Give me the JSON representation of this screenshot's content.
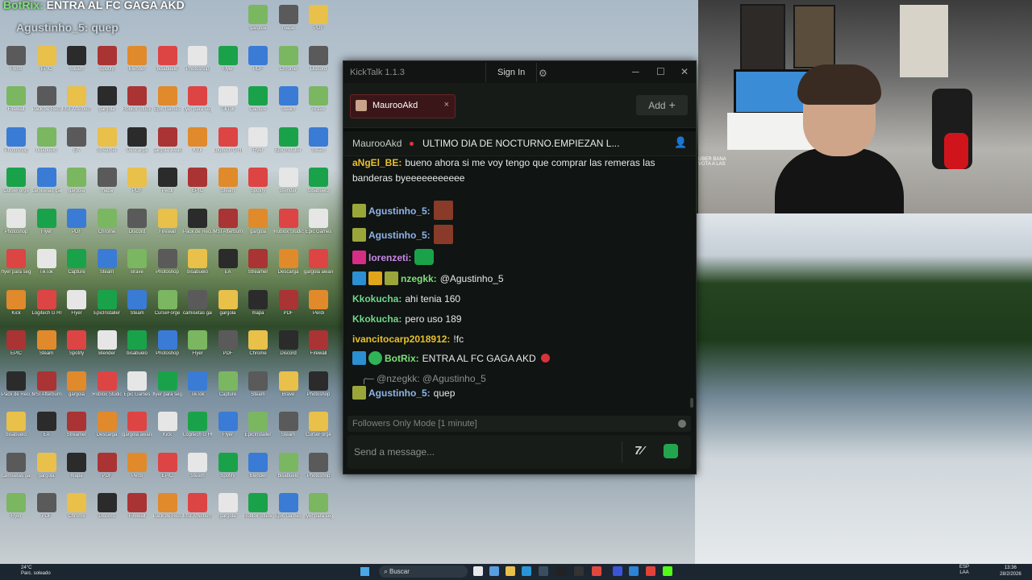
{
  "desktop": {
    "overlay_top_username": "BotRix:",
    "overlay_top_message": "ENTRA AL FC GAGA AKD",
    "overlay_second": "Agustinho_5: quep",
    "icons": [
      "gargola",
      "mapa",
      "PDF",
      "Perdi",
      "EPIC",
      "Steam",
      "Spotify",
      "Blender",
      "bisabuelo",
      "Photoshop",
      "Flyer",
      "PDF",
      "Chrome",
      "Discord",
      "Firewall",
      "Pack de Recursos",
      "MSI Afterburner",
      "gargola",
      "Roblox Studio",
      "Epic Games",
      "flyer para seguir",
      "TikTok",
      "Capture",
      "Steam",
      "Brave",
      "Photoshop",
      "bisabuelo",
      "EA",
      "Streamer",
      "Descarga",
      "gargola awards",
      "Kick",
      "Logitech G HUB",
      "Flyer",
      "EpicInstaller",
      "Steam",
      "CurseForge",
      "camisetas gargolas"
    ]
  },
  "webcam": {
    "overlay_text_1": "UBER BANA",
    "overlay_text_2": "VOTA A LAS"
  },
  "window": {
    "title": "KickTalk 1.1.3",
    "sign_in": "Sign In",
    "settings_icon": "gear-icon",
    "minimize": "─",
    "maximize": "☐",
    "close": "✕"
  },
  "tabs": [
    {
      "name": "MaurooAkd",
      "close": "×"
    }
  ],
  "add_button": {
    "label": "Add",
    "icon": "+"
  },
  "chat_header": {
    "channel": "MaurooAkd",
    "title": "ULTIMO DIA DE NOCTURNO.EMPIEZAN L...",
    "live_color": "#e0343c"
  },
  "messages": [
    {
      "user": "aNgEl_BE:",
      "color": "#e7c12c",
      "text": "bueno ahora si me voy tengo que comprar las remeras las banderas byeeeeeeeeeee"
    },
    {
      "user": "Agustinho_5:",
      "color": "#8fb4e8",
      "text": ""
    },
    {
      "user": "Agustinho_5:",
      "color": "#8fb4e8",
      "text": ""
    },
    {
      "user": "lorenzeti:",
      "color": "#c98ae6",
      "text": ""
    },
    {
      "user": "nzegkk:",
      "color": "#7fe07a",
      "text": "@Agustinho_5"
    },
    {
      "user": "Kkokucha:",
      "color": "#6fd78a",
      "text": "ahi tenia 160"
    },
    {
      "user": "Kkokucha:",
      "color": "#6fd78a",
      "text": "pero uso 189"
    },
    {
      "user": "ivancitocarp2018912:",
      "color": "#e7c12c",
      "text": "!fc"
    },
    {
      "user": "BotRix:",
      "color": "#7fe07a",
      "text": "ENTRA AL FC GAGA AKD"
    },
    {
      "reply": "@nzegkk: @Agustinho_5"
    },
    {
      "user": "Agustinho_5:",
      "color": "#8fb4e8",
      "text": "quep"
    }
  ],
  "mode_bar": "Followers Only Mode [1 minute]",
  "input": {
    "placeholder": "Send a message...",
    "value": ""
  },
  "taskbar": {
    "weather_temp": "24°C",
    "weather_desc": "Parc. soleado",
    "search": "Buscar",
    "lang_1": "ESP",
    "lang_2": "LAA",
    "time": "13:36",
    "date": "28/2/2026"
  },
  "colors": {
    "accent": "#53fc18",
    "tab_bg": "#3b1618",
    "window_bg": "#101412"
  }
}
